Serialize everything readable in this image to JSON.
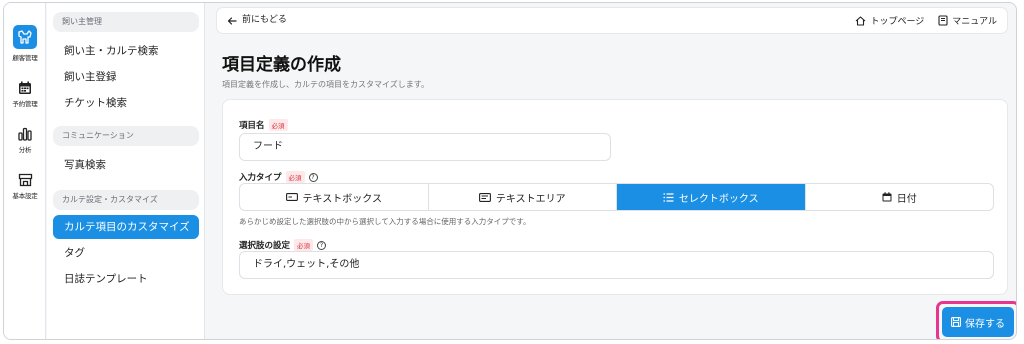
{
  "rail": {
    "items": [
      {
        "label": "顧客管理",
        "icon": "dog-icon",
        "active": true
      },
      {
        "label": "予約管理",
        "icon": "calendar-icon"
      },
      {
        "label": "分析",
        "icon": "bar-chart-icon"
      },
      {
        "label": "基本設定",
        "icon": "store-icon"
      }
    ]
  },
  "sidebar": {
    "sections": [
      {
        "title": "飼い主管理",
        "items": [
          "飼い主・カルテ検索",
          "飼い主登録",
          "チケット検索"
        ]
      },
      {
        "title": "コミュニケーション",
        "items": [
          "写真検索"
        ]
      },
      {
        "title": "カルテ設定・カスタマイズ",
        "items": [
          "カルテ項目のカスタマイズ",
          "タグ",
          "日誌テンプレート"
        ]
      }
    ],
    "active_item": "カルテ項目のカスタマイズ"
  },
  "topbar": {
    "back_label": "前にもどる",
    "top_page_label": "トップページ",
    "manual_label": "マニュアル"
  },
  "page": {
    "title": "項目定義の作成",
    "description": "項目定義を作成し、カルテの項目をカスタマイズします。"
  },
  "form": {
    "item_name": {
      "label": "項目名",
      "required_badge": "必須",
      "value": "フード"
    },
    "input_type": {
      "label": "入力タイプ",
      "required_badge": "必須",
      "options": [
        "テキストボックス",
        "テキストエリア",
        "セレクトボックス",
        "日付"
      ],
      "selected": "セレクトボックス",
      "hint": "あらかじめ設定した選択肢の中から選択して入力する場合に使用する入力タイプです。"
    },
    "choices": {
      "label": "選択肢の設定",
      "required_badge": "必須",
      "value": "ドライ,ウェット,その他"
    }
  },
  "actions": {
    "save_label": "保存する"
  },
  "colors": {
    "accent": "#1a8fe3",
    "highlight": "#e8368f",
    "required": "#d9343b"
  }
}
